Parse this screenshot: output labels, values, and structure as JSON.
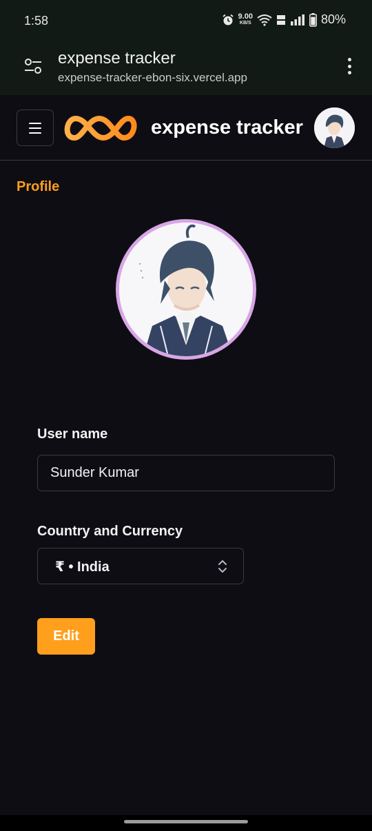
{
  "status_bar": {
    "time": "1:58",
    "net_speed": "9.00",
    "net_unit": "KB/S",
    "battery": "80%"
  },
  "browser": {
    "tab_title": "expense tracker",
    "url": "expense-tracker-ebon-six.vercel.app"
  },
  "app": {
    "title": "expense tracker",
    "accent": "#ff9f1c"
  },
  "page": {
    "title": "Profile"
  },
  "form": {
    "username_label": "User name",
    "username_value": "Sunder Kumar",
    "country_label": "Country and Currency",
    "country_value": "₹ • India",
    "edit_label": "Edit"
  },
  "icons": {
    "menu": "hamburger-icon",
    "select": "chevron-up-down-icon",
    "site_settings": "tune-icon",
    "more": "more-vertical-icon"
  }
}
